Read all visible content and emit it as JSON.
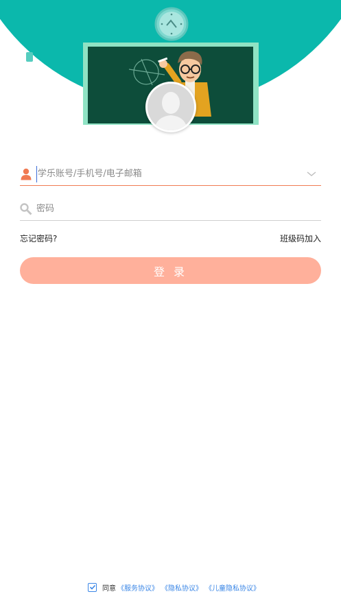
{
  "login": {
    "account_placeholder": "学乐账号/手机号/电子邮箱",
    "password_placeholder": "密码",
    "forgot_password": "忘记密码?",
    "class_code_join": "班级码加入",
    "login_button": "登 录"
  },
  "agreement": {
    "checked": true,
    "prefix": "同意",
    "links": [
      "《服务协议》",
      "《隐私协议》",
      "《儿童隐私协议》"
    ]
  },
  "icons": {
    "account": "person-icon",
    "password": "key-icon",
    "dropdown": "chevron-down-icon",
    "checkbox": "checkmark-icon"
  },
  "colors": {
    "header": "#0bb8ac",
    "accent": "#f07a52",
    "button": "#ffb09b",
    "link": "#3a86e6"
  }
}
